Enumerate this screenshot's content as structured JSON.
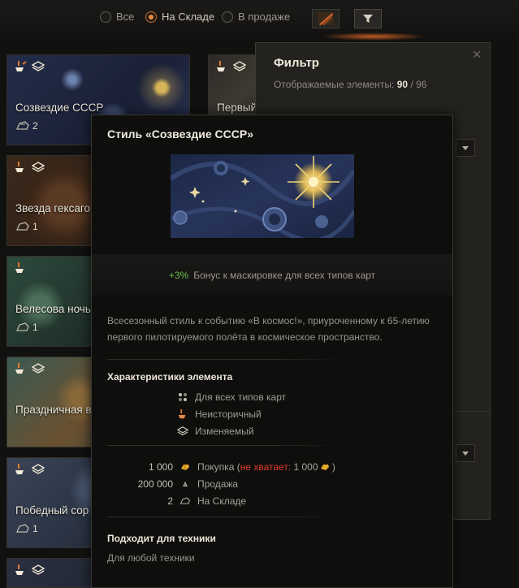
{
  "filter_tabs": [
    {
      "label": "Все",
      "active": false
    },
    {
      "label": "На Складе",
      "active": true
    },
    {
      "label": "В продаже",
      "active": false
    }
  ],
  "toolbar_icons": [
    "paint-brush-icon",
    "funnel-icon"
  ],
  "cards": [
    {
      "name": "Созвездие СССР",
      "count": "2"
    },
    {
      "name": "Звезда гексаго",
      "count": "1"
    },
    {
      "name": "Велесова ночь",
      "count": "1"
    },
    {
      "name": "Праздничная в",
      "count": ""
    },
    {
      "name": "Победный сор",
      "count": "1"
    },
    {
      "name": "Первый",
      "count": ""
    }
  ],
  "filter_panel": {
    "title": "Фильтр",
    "shown_label": "Отображаемые элементы:",
    "shown_count": "90",
    "total_count": "96"
  },
  "tooltip": {
    "title": "Стиль «Созвездие СССР»",
    "bonus_value": "+3%",
    "bonus_text": "Бонус к маскировке для всех типов карт",
    "description": "Всесезонный стиль к событию «В космос!», приуроченному к 65-летию первого пилотируемого полёта в космическое пространство.",
    "characteristics_title": "Характеристики элемента",
    "characteristics": [
      {
        "icon": "all-maps-icon",
        "label": "Для всех типов карт"
      },
      {
        "icon": "non-historical-icon",
        "label": "Неисторичный"
      },
      {
        "icon": "modifiable-icon",
        "label": "Изменяемый"
      }
    ],
    "prices": {
      "buy_value": "1 000",
      "buy_label": "Покупка",
      "buy_open_paren": "(",
      "buy_missing_label": "не хватает:",
      "buy_missing_value": "1 000",
      "buy_close_paren": ")",
      "sell_value": "200 000",
      "sell_label": "Продажа",
      "stock_value": "2",
      "stock_label": "На Складе"
    },
    "fits_title": "Подходит для техники",
    "fits_text": "Для любой техники"
  },
  "colors": {
    "accent": "#f08a3a",
    "bonus_green": "#6cbe4a",
    "warning_red": "#e23c2a",
    "gold": "#e4a72c"
  }
}
